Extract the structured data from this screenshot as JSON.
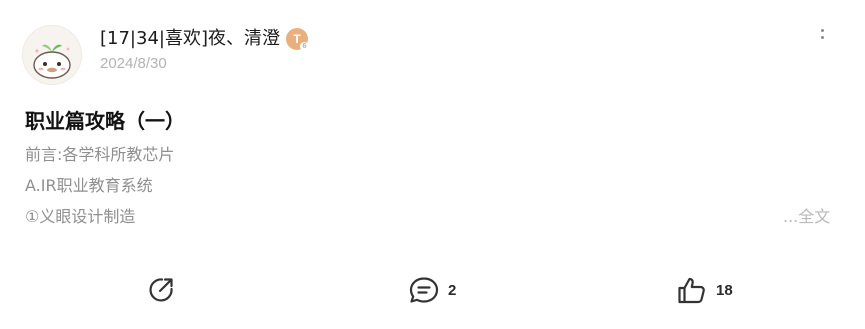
{
  "post": {
    "author_name": "[17|34|喜欢]夜、清澄",
    "badge": {
      "letter": "T",
      "sub": "6",
      "color": "#e9b07f"
    },
    "date": "2024/8/30",
    "title": "职业篇攻略（一）",
    "excerpt_lines": [
      "前言:各学科所教芯片",
      "A.IR职业教育系统",
      "①义眼设计制造"
    ],
    "full_text_link": "...全文"
  },
  "actions": {
    "share": {
      "icon": "share-icon"
    },
    "comment": {
      "icon": "comment-icon",
      "count": "2"
    },
    "like": {
      "icon": "thumbs-up-icon",
      "count": "18"
    }
  },
  "menu": {
    "icon": "more-vertical-icon"
  },
  "colors": {
    "text": "#1b1b1b",
    "muted": "#8f8f8f",
    "date": "#b3b3b3",
    "badge": "#e9b07f"
  }
}
